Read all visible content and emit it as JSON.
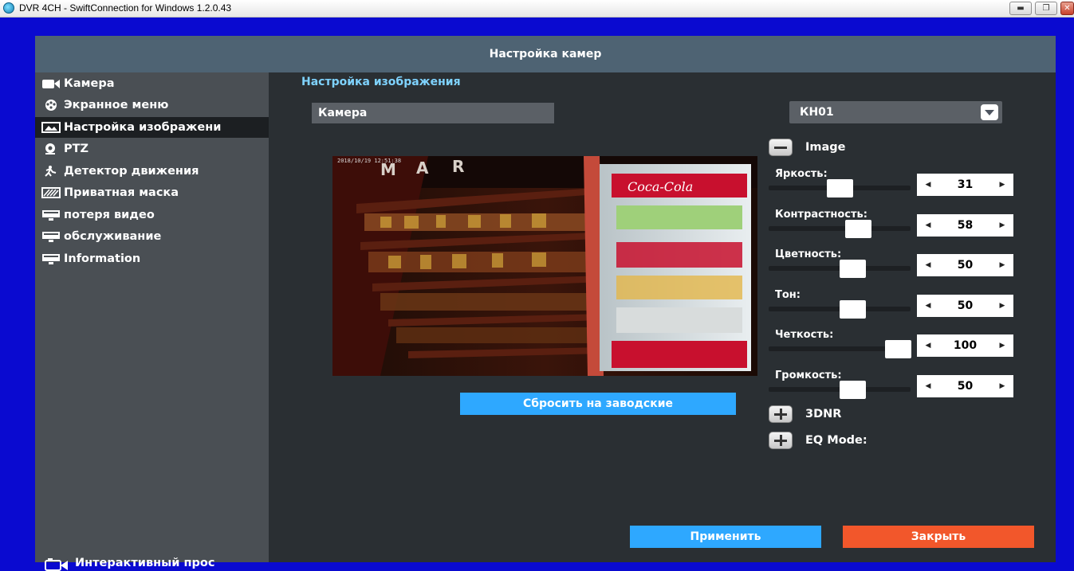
{
  "window": {
    "title": "DVR 4CH - SwiftConnection for Windows 1.2.0.43",
    "controls": [
      "minimize",
      "restore",
      "close"
    ]
  },
  "dialog": {
    "title": "Настройка камер"
  },
  "sidebar": {
    "items": [
      {
        "label": "Камера",
        "icon": "camera-icon",
        "active": false
      },
      {
        "label": "Экранное меню",
        "icon": "osd-icon",
        "active": false
      },
      {
        "label": "Настройка изображени",
        "icon": "image-icon",
        "active": true
      },
      {
        "label": "PTZ",
        "icon": "ptz-icon",
        "active": false
      },
      {
        "label": "Детектор движения",
        "icon": "motion-icon",
        "active": false
      },
      {
        "label": "Приватная маска",
        "icon": "mask-icon",
        "active": false
      },
      {
        "label": "потеря видео",
        "icon": "monitor-icon",
        "active": false
      },
      {
        "label": "обслуживание",
        "icon": "monitor-icon",
        "active": false
      },
      {
        "label": "Information",
        "icon": "monitor-icon",
        "active": false
      }
    ],
    "bottom_label": "Интерактивный прос"
  },
  "main": {
    "section_title": "Настройка изображения",
    "camera_label": "Камера",
    "camera_select": "КН01",
    "preview": {
      "timestamp": "2018/10/19 12:51:38",
      "sign_text": "M A R",
      "fridge_brand": "Coca-Cola"
    },
    "reset_button": "Сбросить на заводские",
    "image_group": {
      "label": "Image",
      "expanded": true
    },
    "params": [
      {
        "label": "Яркость:",
        "value": "31",
        "fraction": 0.31
      },
      {
        "label": "Контрастность:",
        "value": "58",
        "fraction": 0.58
      },
      {
        "label": "Цветность:",
        "value": "50",
        "fraction": 0.5
      },
      {
        "label": "Тон:",
        "value": "50",
        "fraction": 0.5
      },
      {
        "label": "Четкость:",
        "value": "100",
        "fraction": 1.0
      },
      {
        "label": "Громкость:",
        "value": "50",
        "fraction": 0.5
      }
    ],
    "groups": [
      {
        "label": "3DNR",
        "expanded": false
      },
      {
        "label": "EQ Mode:",
        "expanded": false
      }
    ],
    "apply_button": "Применить",
    "close_button": "Закрыть"
  },
  "colors": {
    "desktop": "#0a0ad0",
    "header": "#4e6373",
    "panel": "#2a2f33",
    "sidebar": "#4a4f54",
    "accent_blue": "#2ea8ff",
    "close_orange": "#f2572b",
    "section_title": "#7fd3ff"
  }
}
